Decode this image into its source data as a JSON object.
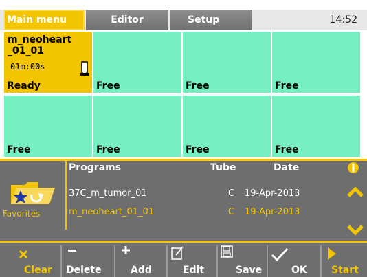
{
  "tabs": [
    {
      "label": "Main menu"
    },
    {
      "label": "Editor"
    },
    {
      "label": "Setup"
    }
  ],
  "clock": "14:52",
  "slots": [
    {
      "name_line1": "m_neoheart",
      "name_line2": "_01_01",
      "time": "01m:00s",
      "status": "Ready"
    },
    {
      "status": "Free"
    },
    {
      "status": "Free"
    },
    {
      "status": "Free"
    },
    {
      "status": "Free"
    },
    {
      "status": "Free"
    },
    {
      "status": "Free"
    },
    {
      "status": "Free"
    }
  ],
  "programs_panel": {
    "favorites_label": "Favorites",
    "headers": {
      "programs": "Programs",
      "tube": "Tube",
      "date": "Date"
    },
    "rows": [
      {
        "program": "37C_m_tumor_01",
        "tube": "C",
        "date": "19-Apr-2013",
        "selected": false
      },
      {
        "program": "m_neoheart_01_01",
        "tube": "C",
        "date": "19-Apr-2013",
        "selected": true
      }
    ],
    "accent": "#f2c500"
  },
  "toolbar": {
    "clear": "Clear",
    "delete": "Delete",
    "add": "Add",
    "edit": "Edit",
    "save": "Save",
    "ok": "OK",
    "start": "Start"
  },
  "colors": {
    "accent": "#f2c500",
    "slot_free": "#77f0c1",
    "panel": "#6e6e6e"
  }
}
